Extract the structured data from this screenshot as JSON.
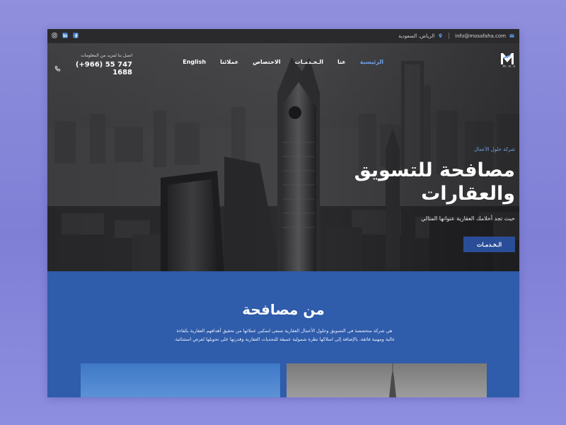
{
  "topbar": {
    "email": "info@mosafaha.com",
    "location": "الرياض، السعودية",
    "social": [
      "instagram-icon",
      "linkedin-icon",
      "facebook-icon"
    ]
  },
  "nav": {
    "logo_sub": "m.o.s",
    "items": [
      {
        "label": "الرئيسية",
        "active": true
      },
      {
        "label": "عنا"
      },
      {
        "label": "الـخـدمـات"
      },
      {
        "label": "الاختصاص"
      },
      {
        "label": "عملائنا"
      },
      {
        "label": "English"
      }
    ]
  },
  "phone": {
    "caption": "اتصل بنا لمزيد من المعلومات",
    "number": "(+966) 55 747 1688"
  },
  "hero": {
    "kicker": "شركة حلول الأعمال",
    "title_line1": "مصافحة للتسويق",
    "title_line2": "والعقارات",
    "subtitle": "حيث تجد أحلامك العقارية عنوانها المثالي",
    "button": "الـخـدمـات"
  },
  "about": {
    "title": "من مصافحة",
    "text": "هي شركة متخصصة في التسويق وحلول الأعمال العقارية تسعى لتمكين عملائها من تحقيق أهدافهم العقارية بكفاءة عالية ومهنية فائقة، بالإضافة إلى امتلاكها نظرة شمولية عميقة للتحديات العقارية وقدرتها على تحويلها لفرص استثنائية."
  },
  "colors": {
    "accent": "#6fa3e8",
    "button": "#2a4d97",
    "section_bg": "#2f5cab",
    "topbar": "#2a2a2c"
  }
}
